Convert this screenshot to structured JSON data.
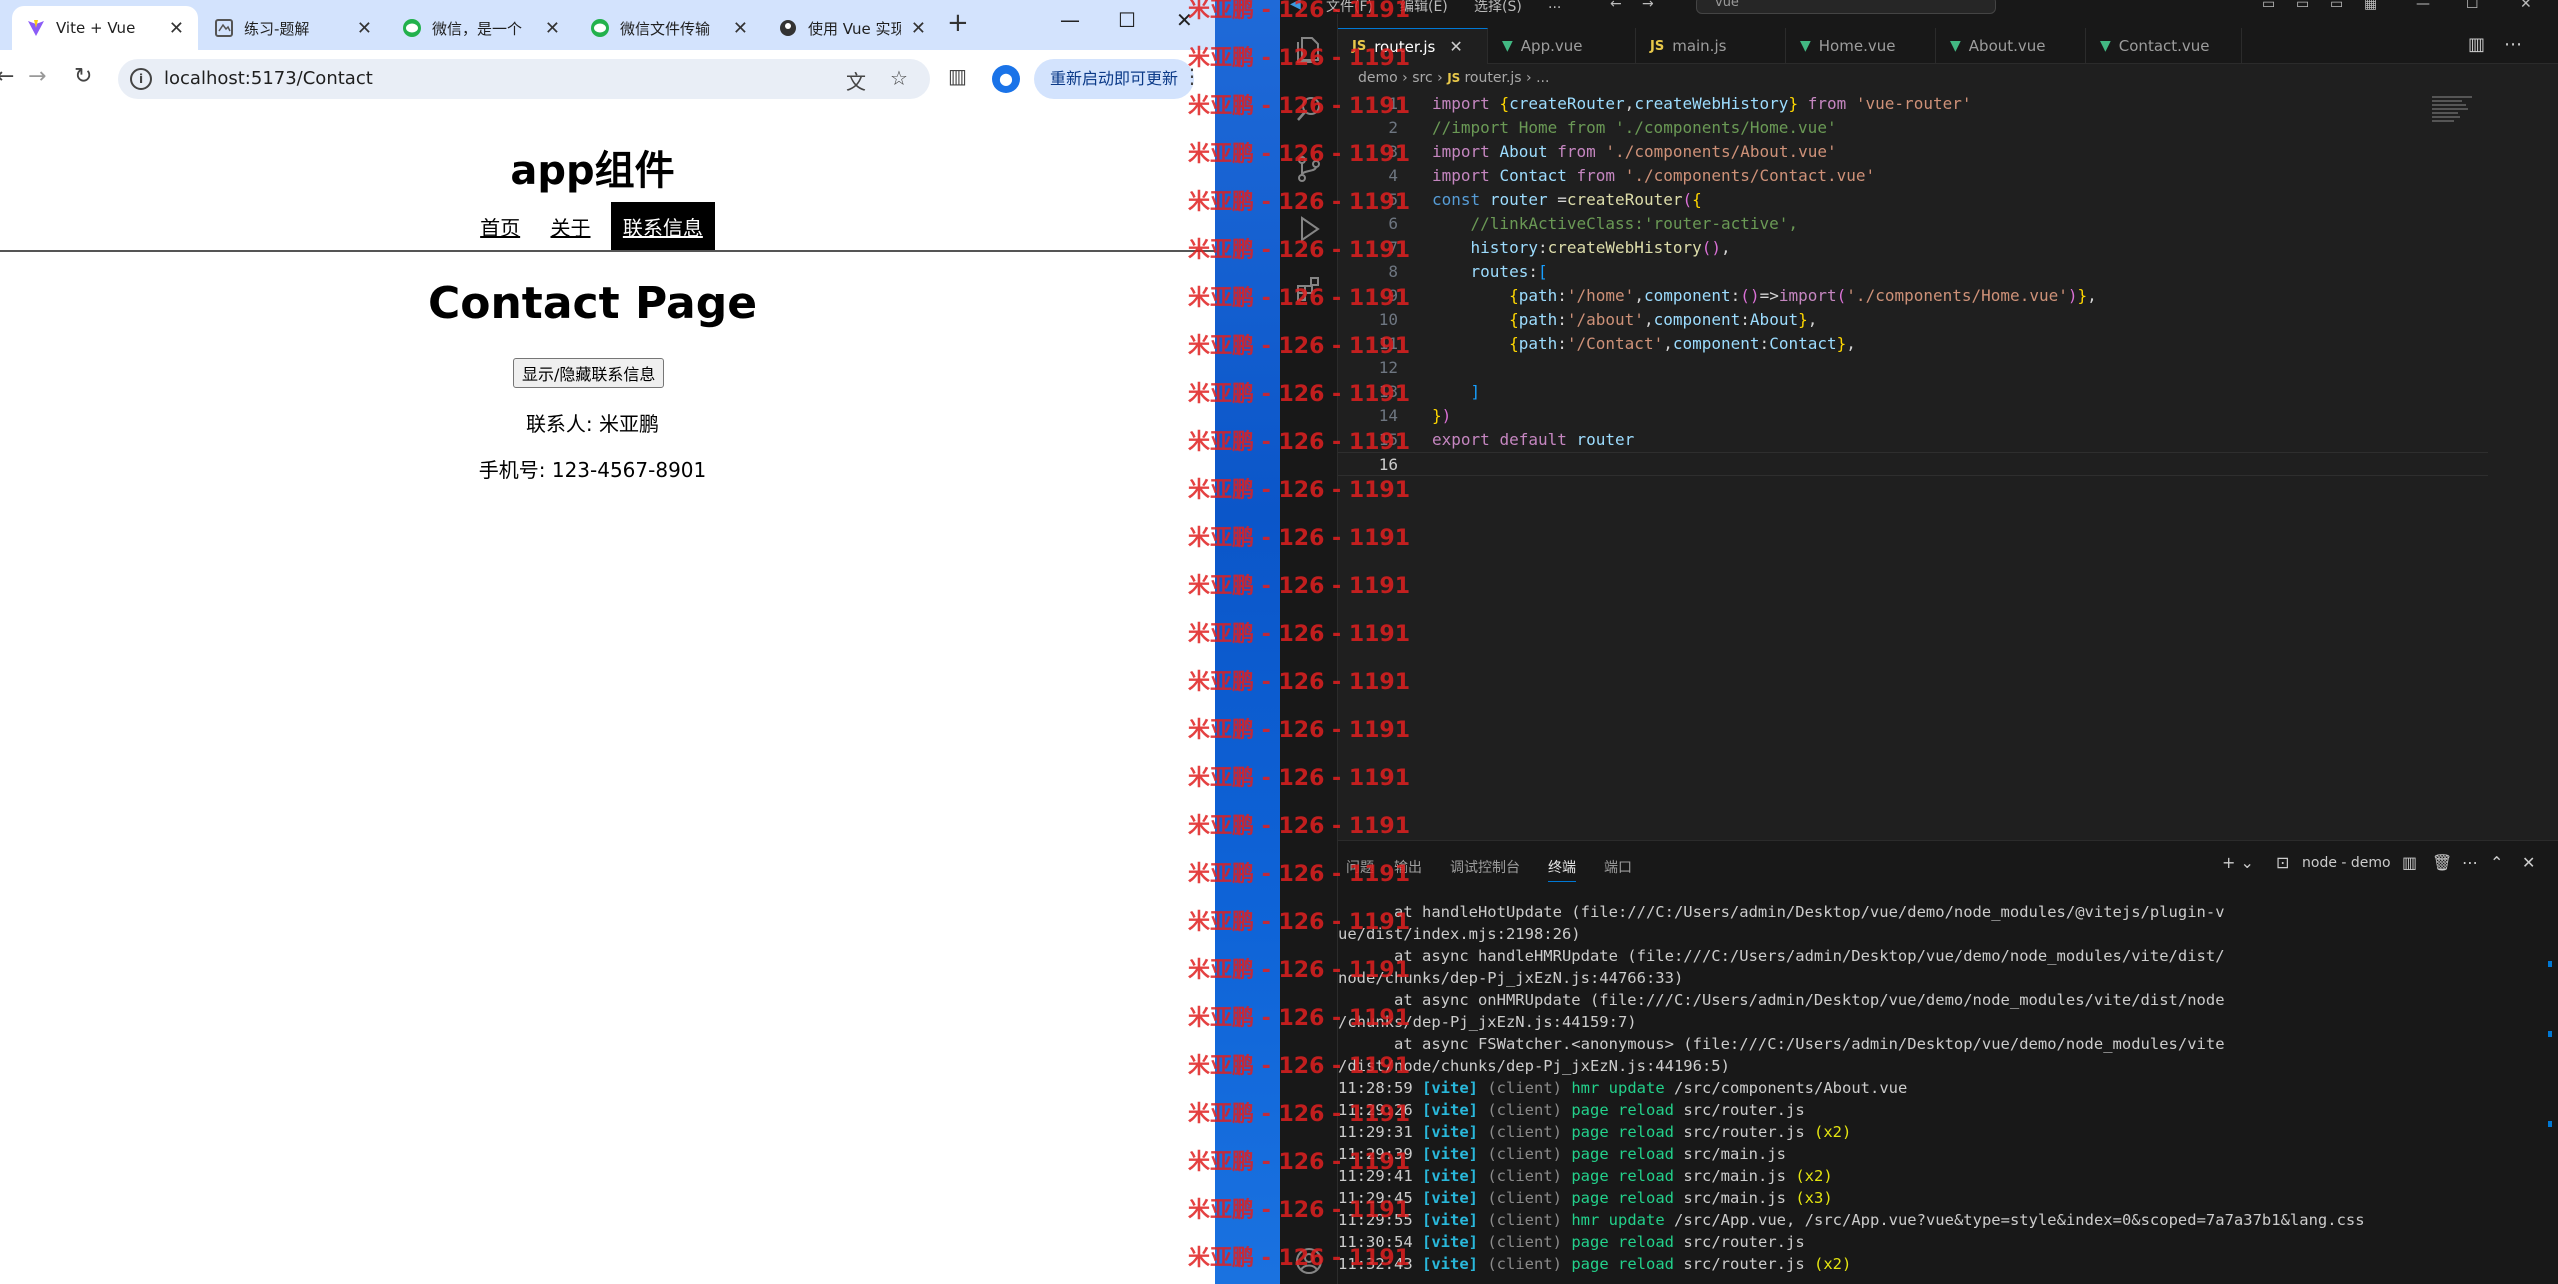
{
  "browser": {
    "tabs": [
      {
        "title": "Vite + Vue",
        "icon": "vite-icon",
        "active": true
      },
      {
        "title": "练习-题解",
        "icon": "page-icon",
        "active": false
      },
      {
        "title": "微信，是一个",
        "icon": "wechat-icon",
        "active": false
      },
      {
        "title": "微信文件传输",
        "icon": "wechat-icon",
        "active": false
      },
      {
        "title": "使用 Vue 实现",
        "icon": "site-icon",
        "active": false
      }
    ],
    "url": "localhost:5173/Contact",
    "update_button": "重新启动即可更新"
  },
  "page": {
    "app_title": "app组件",
    "nav": [
      {
        "label": "首页",
        "active": false
      },
      {
        "label": "关于",
        "active": false
      },
      {
        "label": "联系信息",
        "active": true
      }
    ],
    "heading": "Contact Page",
    "toggle_button": "显示/隐藏联系信息",
    "contact_line": "联系人: 米亚鹏",
    "phone_line": "手机号: 123-4567-8901"
  },
  "watermark": {
    "text": "米亚鹏 - 126 - 1191",
    "color": "#e02020"
  },
  "vscode": {
    "menu": [
      "文件(F)",
      "编辑(E)",
      "选择(S)",
      "..."
    ],
    "search": "vue",
    "tabs": [
      {
        "label": "router.js",
        "type": "js",
        "active": true
      },
      {
        "label": "App.vue",
        "type": "vue",
        "active": false
      },
      {
        "label": "main.js",
        "type": "js",
        "active": false
      },
      {
        "label": "Home.vue",
        "type": "vue",
        "active": false
      },
      {
        "label": "About.vue",
        "type": "vue",
        "active": false
      },
      {
        "label": "Contact.vue",
        "type": "vue",
        "active": false
      }
    ],
    "breadcrumb": [
      "demo",
      "src",
      "router.js",
      "..."
    ],
    "code": [
      "import {createRouter,createWebHistory} from 'vue-router'",
      "//import Home from './components/Home.vue'",
      "import About from './components/About.vue'",
      "import Contact from './components/Contact.vue'",
      "const router =createRouter({",
      "    //linkActiveClass:'router-active',",
      "    history:createWebHistory(),",
      "    routes:[",
      "        {path:'/home',component:()=>import('./components/Home.vue')},",
      "        {path:'/about',component:About},",
      "        {path:'/Contact',component:Contact},",
      "",
      "    ]",
      "})",
      "export default router",
      ""
    ],
    "panel_tabs": [
      {
        "label": "问题",
        "active": false
      },
      {
        "label": "输出",
        "active": false
      },
      {
        "label": "调试控制台",
        "active": false
      },
      {
        "label": "终端",
        "active": true
      },
      {
        "label": "端口",
        "active": false
      }
    ],
    "terminal_name": "node - demo",
    "terminal_stack": [
      "      at handleHotUpdate (file:///C:/Users/admin/Desktop/vue/demo/node_modules/@vitejs/plugin-v",
      "ue/dist/index.mjs:2198:26)",
      "      at async handleHMRUpdate (file:///C:/Users/admin/Desktop/vue/demo/node_modules/vite/dist/",
      "node/chunks/dep-Pj_jxEzN.js:44766:33)",
      "      at async onHMRUpdate (file:///C:/Users/admin/Desktop/vue/demo/node_modules/vite/dist/node",
      "/chunks/dep-Pj_jxEzN.js:44159:7)",
      "      at async FSWatcher.<anonymous> (file:///C:/Users/admin/Desktop/vue/demo/node_modules/vite",
      "/dist/node/chunks/dep-Pj_jxEzN.js:44196:5)"
    ],
    "terminal_log": [
      {
        "time": "11:28:59",
        "tag": "[vite]",
        "client": "(client)",
        "action": "hmr update",
        "file": "/src/components/About.vue",
        "count": ""
      },
      {
        "time": "11:29:26",
        "tag": "[vite]",
        "client": "(client)",
        "action": "page reload",
        "file": "src/router.js",
        "count": ""
      },
      {
        "time": "11:29:31",
        "tag": "[vite]",
        "client": "(client)",
        "action": "page reload",
        "file": "src/router.js",
        "count": "(x2)"
      },
      {
        "time": "11:29:39",
        "tag": "[vite]",
        "client": "(client)",
        "action": "page reload",
        "file": "src/main.js",
        "count": ""
      },
      {
        "time": "11:29:41",
        "tag": "[vite]",
        "client": "(client)",
        "action": "page reload",
        "file": "src/main.js",
        "count": "(x2)"
      },
      {
        "time": "11:29:45",
        "tag": "[vite]",
        "client": "(client)",
        "action": "page reload",
        "file": "src/main.js",
        "count": "(x3)"
      },
      {
        "time": "11:29:55",
        "tag": "[vite]",
        "client": "(client)",
        "action": "hmr update",
        "file": "/src/App.vue, /src/App.vue?vue&type=style&index=0&scoped=7a7a37b1&lang.css",
        "count": ""
      },
      {
        "time": "11:30:54",
        "tag": "[vite]",
        "client": "(client)",
        "action": "page reload",
        "file": "src/router.js",
        "count": ""
      },
      {
        "time": "11:32:43",
        "tag": "[vite]",
        "client": "(client)",
        "action": "page reload",
        "file": "src/router.js",
        "count": "(x2)"
      }
    ]
  }
}
